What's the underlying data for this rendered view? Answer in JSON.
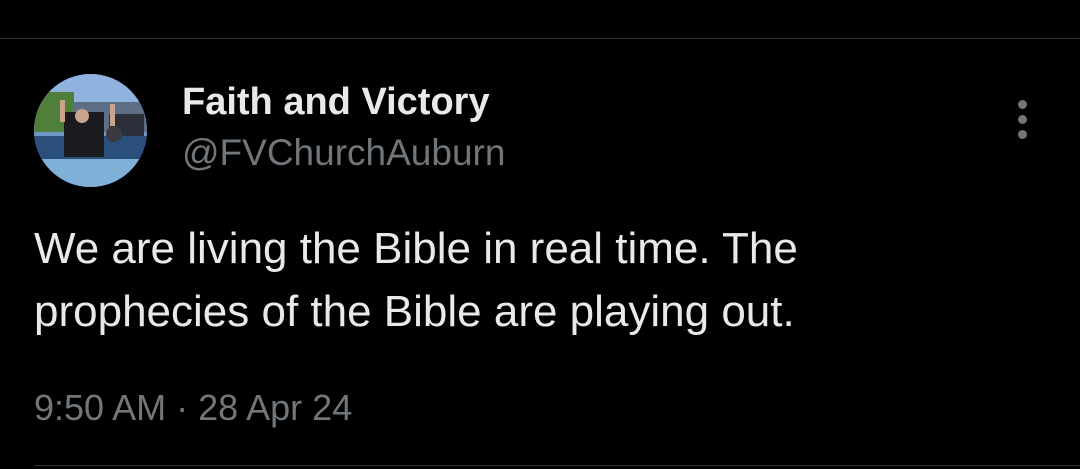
{
  "tweet": {
    "author": {
      "name": "Faith and Victory",
      "handle": "@FVChurchAuburn"
    },
    "text": "We are living the Bible in real time.  The\nprophecies of the Bible are playing out.",
    "time": "9:50 AM",
    "separator": "·",
    "date": "28 Apr 24",
    "more_icon": "more-vertical-icon"
  },
  "colors": {
    "background": "#000000",
    "primary_text": "#e7e9ea",
    "secondary_text": "#71767b",
    "divider": "#2f3336"
  }
}
